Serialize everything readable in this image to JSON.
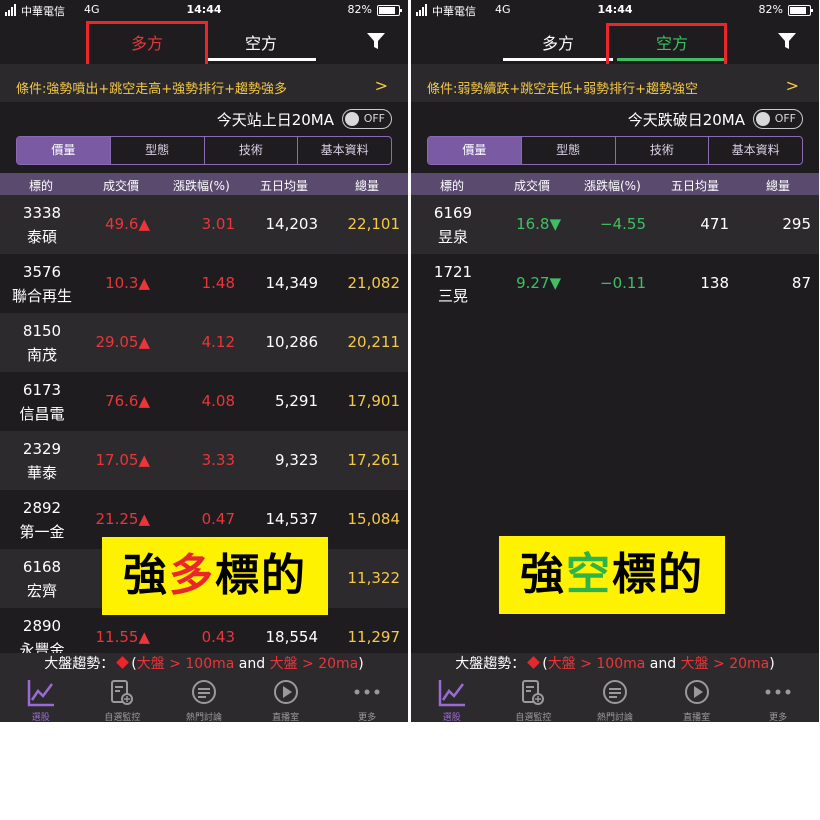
{
  "left": {
    "status": {
      "carrier": "中華電信",
      "network": "4G",
      "time": "14:44",
      "battery": "82%"
    },
    "tabs": [
      "多方",
      "空方"
    ],
    "active_tab": 0,
    "condition": "條件:強勢噴出+跳空走高+強勢排行+趨勢強多",
    "ma_label": "今天站上日20MA",
    "toggle": "OFF",
    "segments": [
      "價量",
      "型態",
      "技術",
      "基本資料"
    ],
    "columns": [
      "標的",
      "成交價",
      "漲跌幅(%)",
      "五日均量",
      "總量"
    ],
    "rows": [
      {
        "code": "3338",
        "name": "泰碩",
        "price": "49.6▲",
        "change": "3.01",
        "avg5": "14,203",
        "volume": "22,101"
      },
      {
        "code": "3576",
        "name": "聯合再生",
        "price": "10.3▲",
        "change": "1.48",
        "avg5": "14,349",
        "volume": "21,082"
      },
      {
        "code": "8150",
        "name": "南茂",
        "price": "29.05▲",
        "change": "4.12",
        "avg5": "10,286",
        "volume": "20,211"
      },
      {
        "code": "6173",
        "name": "信昌電",
        "price": "76.6▲",
        "change": "4.08",
        "avg5": "5,291",
        "volume": "17,901"
      },
      {
        "code": "2329",
        "name": "華泰",
        "price": "17.05▲",
        "change": "3.33",
        "avg5": "9,323",
        "volume": "17,261"
      },
      {
        "code": "2892",
        "name": "第一金",
        "price": "21.25▲",
        "change": "0.47",
        "avg5": "14,537",
        "volume": "15,084"
      },
      {
        "code": "6168",
        "name": "宏齊",
        "price": "",
        "change": "",
        "avg5": "",
        "volume": "11,322"
      },
      {
        "code": "2890",
        "name": "永豐金",
        "price": "11.55▲",
        "change": "0.43",
        "avg5": "18,554",
        "volume": "11,297"
      }
    ],
    "banner": {
      "pre": "強",
      "mid": "多",
      "post": "標的"
    },
    "trend": {
      "label": "大盤趨勢：",
      "open": "(",
      "a1": "大盤",
      "a2": " > 100ma",
      "and": " and ",
      "b1": "大盤",
      "b2": " > 20ma",
      "close": ")"
    },
    "tabbar": [
      "選股",
      "自選監控",
      "熱門討論",
      "直播室",
      "更多"
    ]
  },
  "right": {
    "status": {
      "carrier": "中華電信",
      "network": "4G",
      "time": "14:44",
      "battery": "82%"
    },
    "tabs": [
      "多方",
      "空方"
    ],
    "active_tab": 1,
    "condition": "條件:弱勢續跌+跳空走低+弱勢排行+趨勢強空",
    "ma_label": "今天跌破日20MA",
    "toggle": "OFF",
    "segments": [
      "價量",
      "型態",
      "技術",
      "基本資料"
    ],
    "columns": [
      "標的",
      "成交價",
      "漲跌幅(%)",
      "五日均量",
      "總量"
    ],
    "rows": [
      {
        "code": "6169",
        "name": "昱泉",
        "price": "16.8▼",
        "change": "−4.55",
        "avg5": "471",
        "volume": "295"
      },
      {
        "code": "1721",
        "name": "三晃",
        "price": "9.27▼",
        "change": "−0.11",
        "avg5": "138",
        "volume": "87"
      }
    ],
    "banner": {
      "pre": "強",
      "mid": "空",
      "post": "標的"
    },
    "trend": {
      "label": "大盤趨勢：",
      "open": "(",
      "a1": "大盤",
      "a2": " > 100ma",
      "and": " and ",
      "b1": "大盤",
      "b2": " > 20ma",
      "close": ")"
    },
    "tabbar": [
      "選股",
      "自選監控",
      "熱門討論",
      "直播室",
      "更多"
    ]
  },
  "colors": {
    "up": "#e8363a",
    "down": "#3fbf62",
    "gold": "#f4c947",
    "accent": "#7a5aa3",
    "highlight_box": "#e8262b"
  },
  "icons": [
    "filter-icon",
    "chart-icon",
    "watch-doc-icon",
    "chat-icon",
    "play-icon",
    "more-icon"
  ]
}
